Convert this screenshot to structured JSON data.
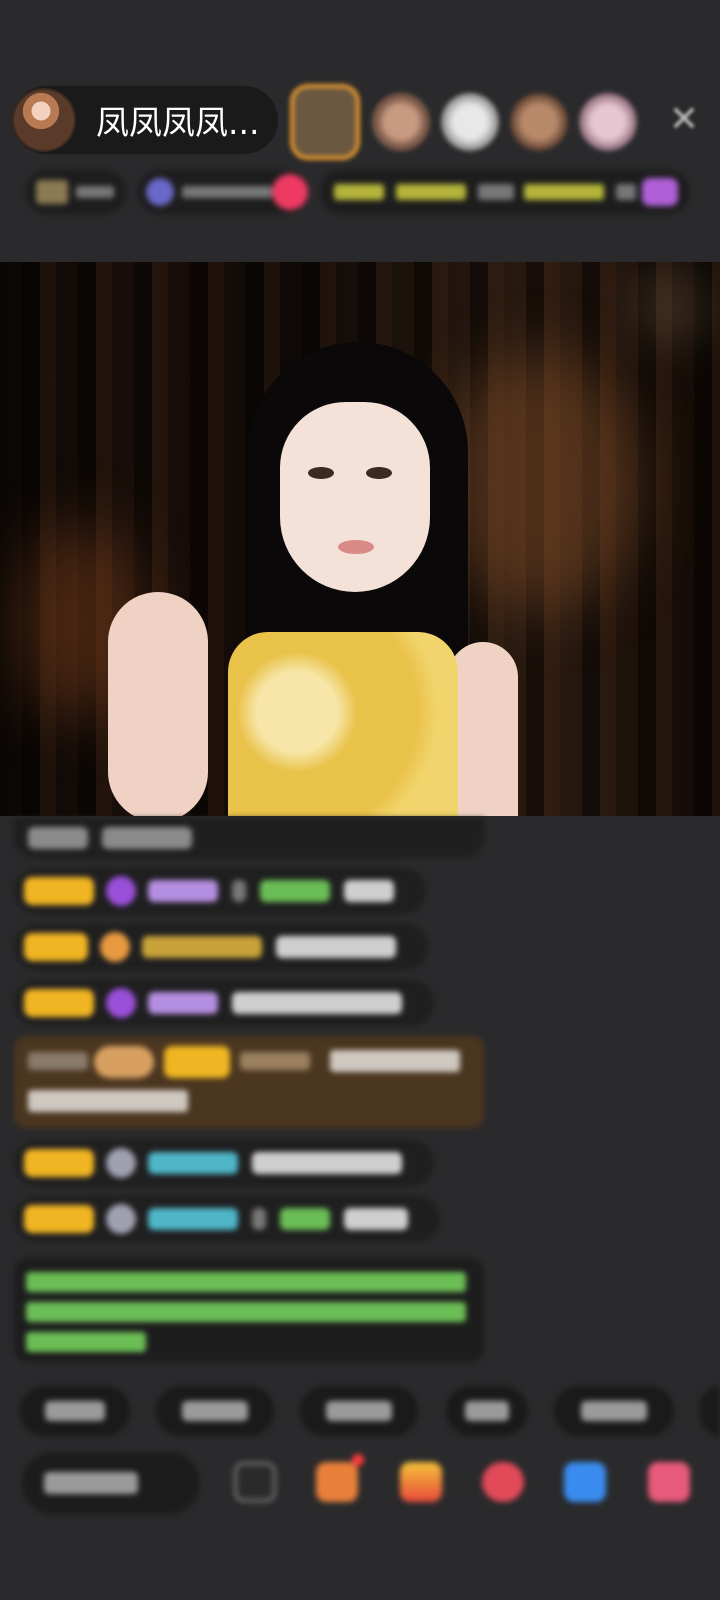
{
  "host": {
    "name": "凤凤凤凤..."
  },
  "colors": {
    "background": "#2a2a2c",
    "badge_gold": "#f0b522",
    "gift_card": "#4b3620",
    "notice_text": "#6bbd55",
    "username_purple": "#b48ee0",
    "username_blue": "#4fb6c8",
    "close_red": "#ff3b3b"
  },
  "icons": {
    "close": "close-icon",
    "emoji": "emoji-icon",
    "gift_box": "gift-box-icon",
    "gift": "gift-icon",
    "game": "game-icon",
    "share": "share-icon",
    "more": "more-icon"
  }
}
